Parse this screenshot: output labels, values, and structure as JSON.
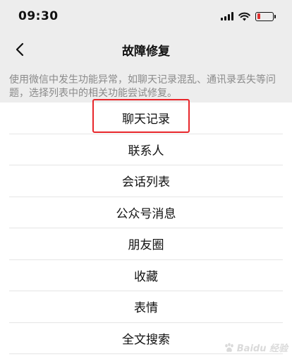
{
  "status_bar": {
    "time": "09:30",
    "signal_icon": "signal-bars-icon",
    "wifi_icon": "wifi-icon",
    "battery_icon": "battery-icon",
    "battery_level": 0.2,
    "battery_color": "#e0312f"
  },
  "nav": {
    "back_icon": "chevron-left-icon",
    "title": "故障修复"
  },
  "description": "使用微信中发生功能异常，如聊天记录混乱、通讯录丢失等问题，选择列表中的相关功能尝试修复。",
  "list_items": [
    {
      "label": "聊天记录",
      "highlighted": true
    },
    {
      "label": "联系人"
    },
    {
      "label": "会话列表"
    },
    {
      "label": "公众号消息"
    },
    {
      "label": "朋友圈"
    },
    {
      "label": "收藏"
    },
    {
      "label": "表情"
    },
    {
      "label": "全文搜索"
    }
  ],
  "highlight_color": "#e8262b",
  "watermark": {
    "text": "Baidu 经验",
    "icon": "baidu-paw-icon"
  }
}
